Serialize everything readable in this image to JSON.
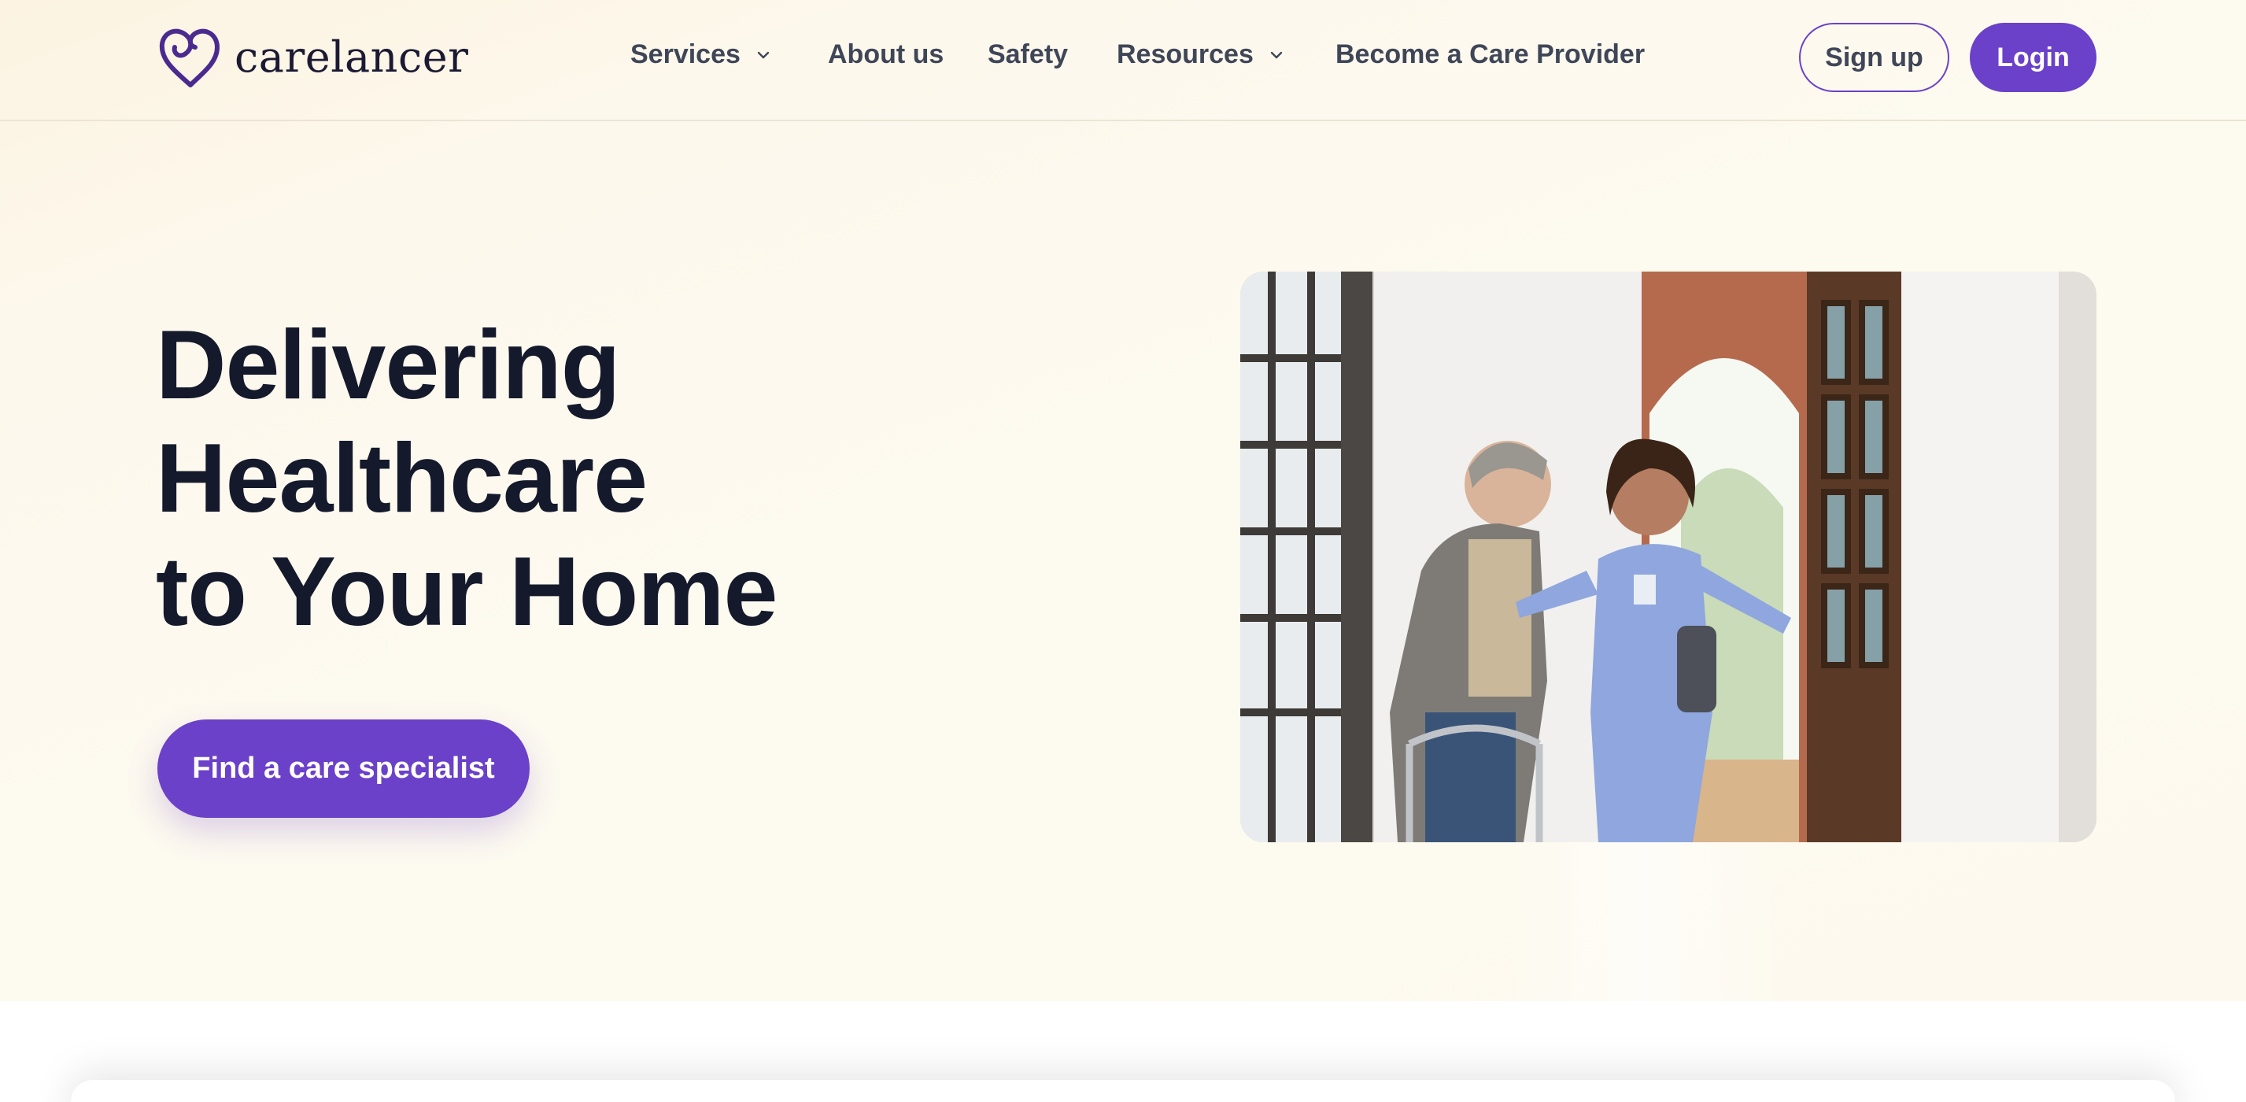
{
  "brand": {
    "name": "carelancer",
    "logo_icon": "heart-logo-icon",
    "color": "#6a41c8"
  },
  "nav": {
    "items": [
      {
        "label": "Services",
        "has_dropdown": true
      },
      {
        "label": "About us",
        "has_dropdown": false
      },
      {
        "label": "Safety",
        "has_dropdown": false
      },
      {
        "label": "Resources",
        "has_dropdown": true
      },
      {
        "label": "Become a Care Provider",
        "has_dropdown": false
      }
    ]
  },
  "auth": {
    "signup_label": "Sign up",
    "login_label": "Login"
  },
  "hero": {
    "title_lines": [
      "Delivering",
      "Healthcare",
      "to Your Home"
    ],
    "cta_label": "Find a care specialist"
  },
  "colors": {
    "accent": "#6a41c8",
    "heading": "#141a2c",
    "nav_text": "#3f4658",
    "hero_bg": "#fdf9ee"
  }
}
